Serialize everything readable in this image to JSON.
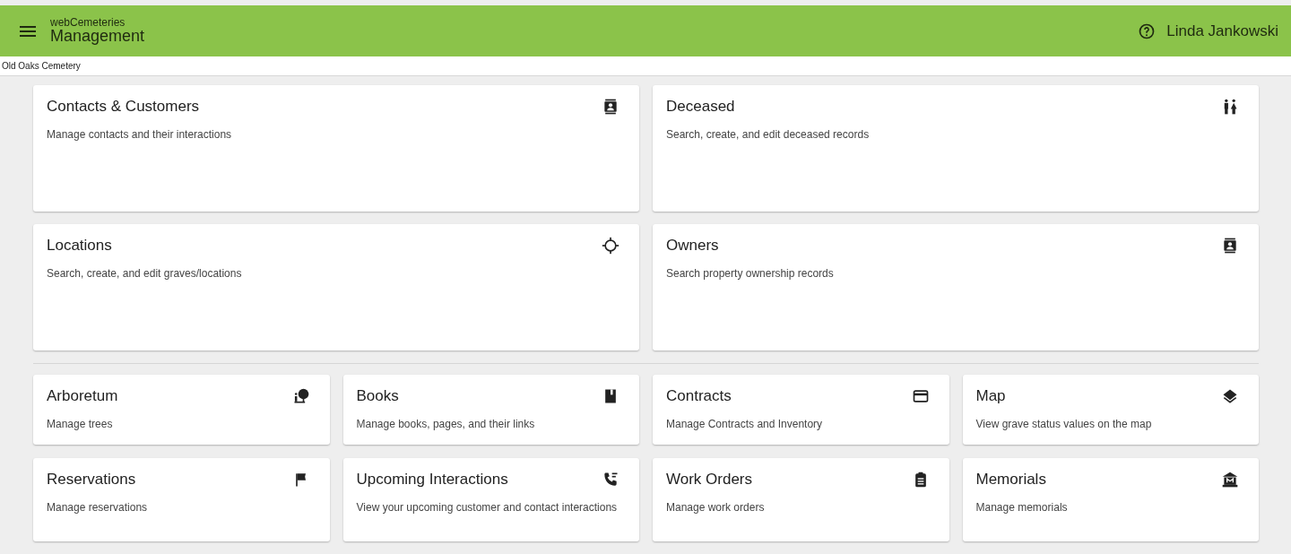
{
  "header": {
    "app_name": "webCemeteries",
    "title": "Management",
    "user": "Linda Jankowski"
  },
  "breadcrumb": "Old Oaks Cemetery",
  "large_cards": [
    {
      "title": "Contacts & Customers",
      "description": "Manage contacts and their interactions"
    },
    {
      "title": "Deceased",
      "description": "Search, create, and edit deceased records"
    },
    {
      "title": "Locations",
      "description": "Search, create, and edit graves/locations"
    },
    {
      "title": "Owners",
      "description": "Search property ownership records"
    }
  ],
  "small_cards": [
    {
      "title": "Arboretum",
      "description": "Manage trees"
    },
    {
      "title": "Books",
      "description": "Manage books, pages, and their links"
    },
    {
      "title": "Contracts",
      "description": "Manage Contracts and Inventory"
    },
    {
      "title": "Map",
      "description": "View grave status values on the map"
    },
    {
      "title": "Reservations",
      "description": "Manage reservations"
    },
    {
      "title": "Upcoming Interactions",
      "description": "View your upcoming customer and contact interactions"
    },
    {
      "title": "Work Orders",
      "description": "Manage work orders"
    },
    {
      "title": "Memorials",
      "description": "Manage memorials"
    }
  ]
}
